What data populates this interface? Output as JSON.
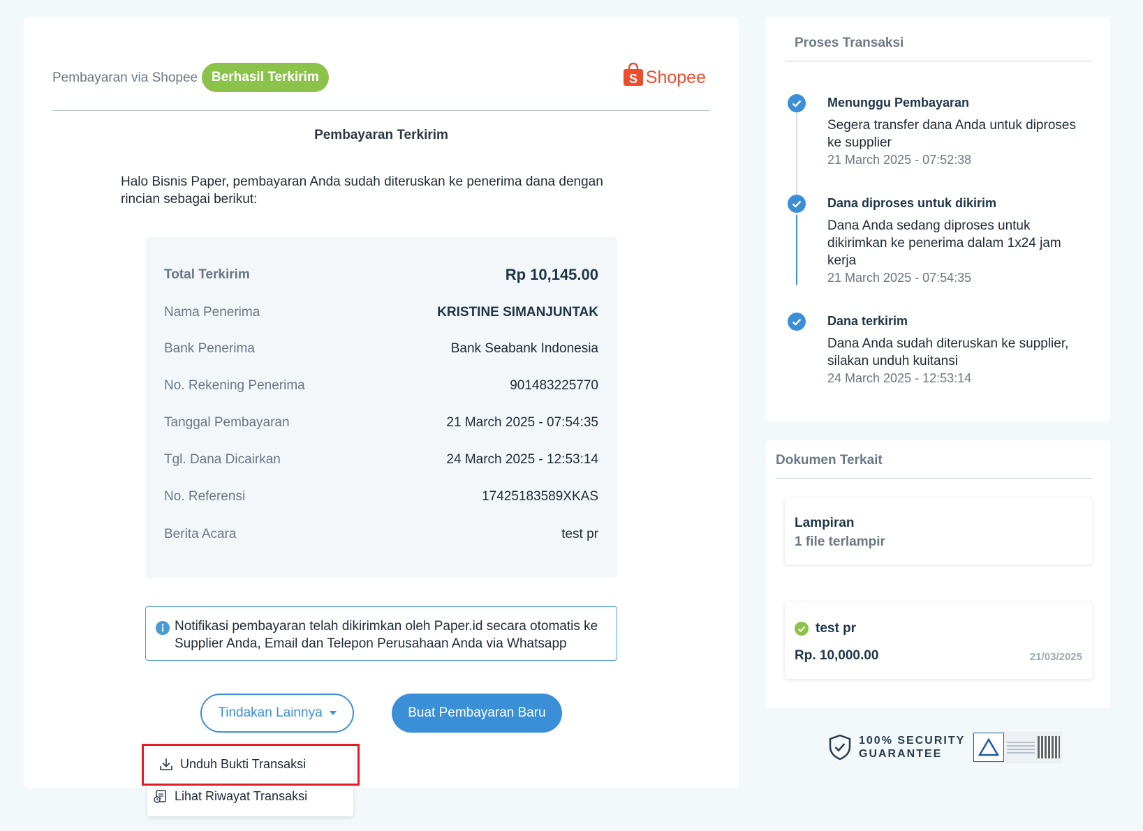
{
  "header": {
    "label": "Pembayaran via Shopee",
    "status": "Berhasil Terkirim",
    "logo_text": "Shopee"
  },
  "main": {
    "title": "Pembayaran Terkirim",
    "intro": "Halo Bisnis Paper, pembayaran Anda sudah diteruskan ke penerima dana dengan rincian sebagai berikut:",
    "details": [
      {
        "label": "Total Terkirim",
        "value": "Rp 10,145.00"
      },
      {
        "label": "Nama Penerima",
        "value": "KRISTINE SIMANJUNTAK"
      },
      {
        "label": "Bank Penerima",
        "value": "Bank Seabank Indonesia"
      },
      {
        "label": "No. Rekening Penerima",
        "value": "901483225770"
      },
      {
        "label": "Tanggal Pembayaran",
        "value": "21 March 2025 - 07:54:35"
      },
      {
        "label": "Tgl. Dana Dicairkan",
        "value": "24 March 2025 - 12:53:14"
      },
      {
        "label": "No. Referensi",
        "value": "17425183589XKAS"
      },
      {
        "label": "Berita Acara",
        "value": "test pr"
      }
    ],
    "notice": "Notifikasi pembayaran telah dikirimkan oleh Paper.id secara otomatis ke Supplier Anda, Email dan Telepon Perusahaan Anda via Whatsapp",
    "more_actions_label": "Tindakan Lainnya",
    "new_payment_label": "Buat Pembayaran Baru",
    "dropdown": [
      {
        "label": "Unduh Bukti Transaksi",
        "icon": "download-icon"
      },
      {
        "label": "Lihat Riwayat Transaksi",
        "icon": "history-icon"
      }
    ]
  },
  "process": {
    "title": "Proses Transaksi",
    "steps": [
      {
        "title": "Menunggu Pembayaran",
        "desc": "Segera transfer dana Anda untuk diproses ke supplier",
        "time": "21 March 2025 - 07:52:38"
      },
      {
        "title": "Dana diproses untuk dikirim",
        "desc": "Dana Anda sedang diproses untuk dikirimkan ke penerima dalam 1x24 jam kerja",
        "time": "21 March 2025 - 07:54:35"
      },
      {
        "title": "Dana terkirim",
        "desc": "Dana Anda sudah diteruskan ke supplier, silakan unduh kuitansi",
        "time": "24 March 2025 - 12:53:14"
      }
    ]
  },
  "documents": {
    "title": "Dokumen Terkait",
    "attachment": {
      "title": "Lampiran",
      "subtitle": "1 file terlampir"
    },
    "item": {
      "name": "test pr",
      "amount": "Rp. 10,000.00",
      "date": "21/03/2025"
    }
  },
  "security": {
    "line1": "100% SECURITY",
    "line2": "GUARANTEE"
  },
  "colors": {
    "primary": "#3a8fd6",
    "success": "#8bc34a",
    "shopee": "#ee4d2d",
    "highlight": "#e51c23"
  }
}
